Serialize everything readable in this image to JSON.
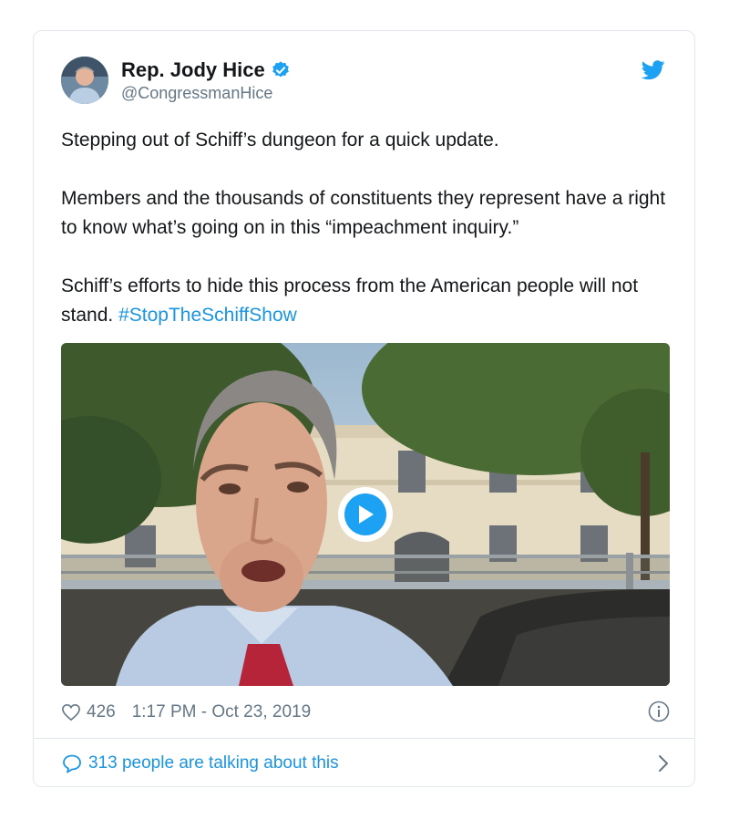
{
  "author": {
    "display_name": "Rep. Jody Hice",
    "handle": "@CongressmanHice",
    "avatar_icon": "profile-photo",
    "verified_icon": "verified-badge-icon"
  },
  "brand": {
    "icon": "twitter-bird-icon",
    "color": "#1da1f2"
  },
  "tweet": {
    "paragraph_1": "Stepping out of Schiff’s dungeon for a quick update.",
    "paragraph_2": "Members and the thousands of constituents they represent have a right to know what’s going on in this “impeachment inquiry.”",
    "paragraph_3_text": "Schiff’s efforts to hide this process from the American people will not stand.",
    "hashtag": "#StopTheSchiffShow",
    "hashtag_color": "#1b95e0"
  },
  "media": {
    "type": "video",
    "play_icon": "play-icon"
  },
  "meta": {
    "like_icon": "heart-icon",
    "likes": "426",
    "timestamp": "1:17 PM - Oct 23, 2019",
    "info_icon": "info-icon"
  },
  "conversation": {
    "icon": "speech-bubble-icon",
    "label": "313 people are talking about this",
    "chevron_icon": "chevron-right-icon"
  }
}
